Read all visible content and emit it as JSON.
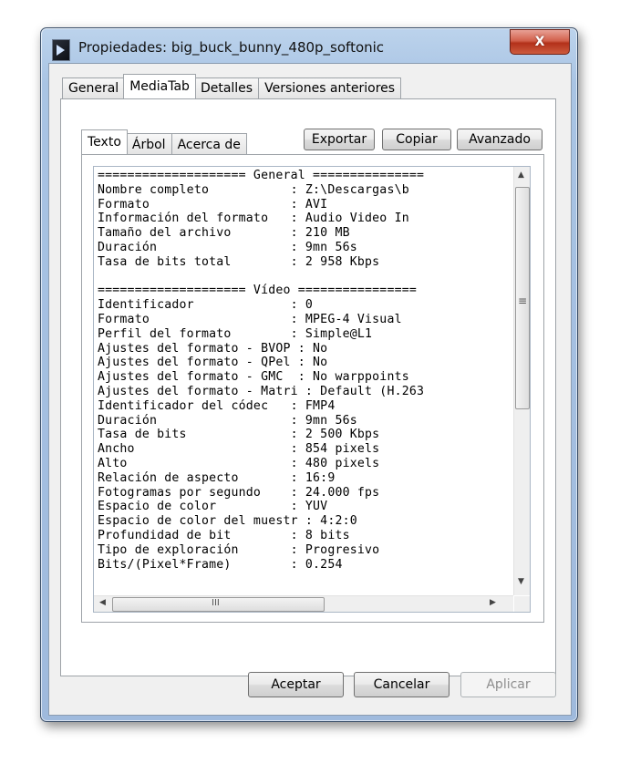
{
  "window": {
    "title": "Propiedades: big_buck_bunny_480p_softonic",
    "close_label": "X"
  },
  "tabs": [
    "General",
    "MediaTab",
    "Detalles",
    "Versiones anteriores"
  ],
  "inner_tabs": [
    "Texto",
    "Árbol",
    "Acerca de"
  ],
  "toolbar": {
    "export_label": "Exportar",
    "copy_label": "Copiar",
    "advanced_label": "Avanzado"
  },
  "report_text": "==================== General ===============\nNombre completo           : Z:\\Descargas\\b\nFormato                   : AVI\nInformación del formato   : Audio Video In\nTamaño del archivo        : 210 MB\nDuración                  : 9mn 56s\nTasa de bits total        : 2 958 Kbps\n\n==================== Vídeo ================\nIdentificador             : 0\nFormato                   : MPEG-4 Visual\nPerfil del formato        : Simple@L1\nAjustes del formato - BVOP : No\nAjustes del formato - QPel : No\nAjustes del formato - GMC  : No warppoints\nAjustes del formato - Matri : Default (H.263\nIdentificador del códec   : FMP4\nDuración                  : 9mn 56s\nTasa de bits              : 2 500 Kbps\nAncho                     : 854 pixels\nAlto                      : 480 pixels\nRelación de aspecto       : 16:9\nFotogramas por segundo    : 24.000 fps\nEspacio de color          : YUV\nEspacio de color del muestr : 4:2:0\nProfundidad de bit        : 8 bits\nTipo de exploración       : Progresivo\nBits/(Pixel*Frame)        : 0.254",
  "scrollbar": {
    "grip": "≡",
    "hgrip": "III"
  },
  "footer": {
    "ok_label": "Aceptar",
    "cancel_label": "Cancelar",
    "apply_label": "Aplicar"
  }
}
